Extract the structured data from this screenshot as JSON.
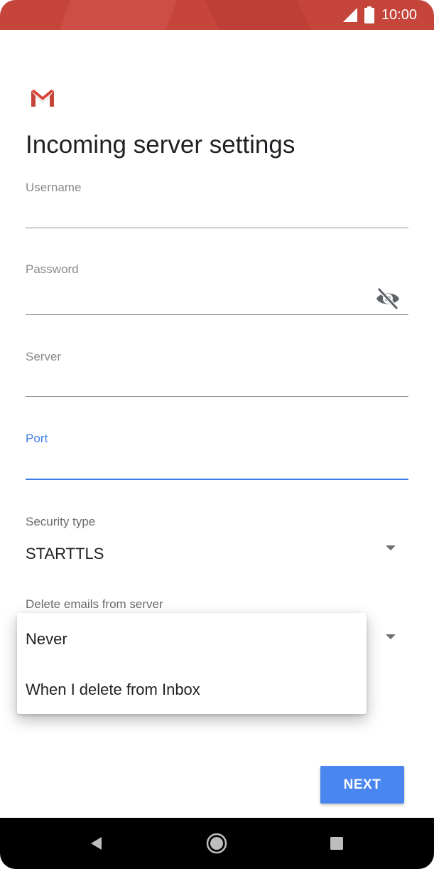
{
  "status_bar": {
    "time": "10:00"
  },
  "screen": {
    "title": "Incoming server settings"
  },
  "form": {
    "username": {
      "label": "Username",
      "value": ""
    },
    "password": {
      "label": "Password",
      "value": ""
    },
    "server": {
      "label": "Server",
      "value": ""
    },
    "port": {
      "label": "Port",
      "value": ""
    },
    "security_type": {
      "label": "Security type",
      "value": "STARTTLS"
    },
    "delete_emails": {
      "label": "Delete emails from server",
      "options": [
        "Never",
        "When I delete from Inbox"
      ]
    }
  },
  "actions": {
    "next_label": "NEXT"
  },
  "colors": {
    "accent": "#4a86f0",
    "status_bar": "#c5453b",
    "focus": "#3f7ee8"
  },
  "icons": [
    "signal-icon",
    "battery-icon",
    "gmail-logo",
    "visibility-off-icon",
    "dropdown-arrow-icon",
    "back-icon",
    "home-icon",
    "recents-icon"
  ]
}
